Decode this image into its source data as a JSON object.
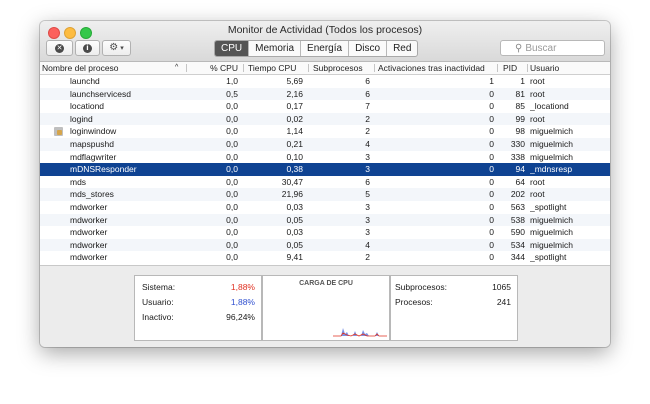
{
  "window": {
    "title": "Monitor de Actividad (Todos los procesos)"
  },
  "toolbar": {
    "stop_icon": "x-circle-icon",
    "info_icon": "info-icon",
    "gear_icon": "gear-icon",
    "tabs": [
      {
        "label": "CPU",
        "active": true
      },
      {
        "label": "Memoria",
        "active": false
      },
      {
        "label": "Energía",
        "active": false
      },
      {
        "label": "Disco",
        "active": false
      },
      {
        "label": "Red",
        "active": false
      }
    ],
    "search_placeholder": "Buscar"
  },
  "table": {
    "columns": [
      "Nombre del proceso",
      "% CPU",
      "Tiempo CPU",
      "Subprocesos",
      "Activaciones tras inactividad",
      "PID",
      "Usuario"
    ],
    "rows": [
      {
        "name": "launchd",
        "cpu": "1,0",
        "time": "5,69",
        "threads": "6",
        "wakes": "1",
        "pid": "1",
        "user": "root"
      },
      {
        "name": "launchservicesd",
        "cpu": "0,5",
        "time": "2,16",
        "threads": "6",
        "wakes": "0",
        "pid": "81",
        "user": "root"
      },
      {
        "name": "locationd",
        "cpu": "0,0",
        "time": "0,17",
        "threads": "7",
        "wakes": "0",
        "pid": "85",
        "user": "_locationd"
      },
      {
        "name": "logind",
        "cpu": "0,0",
        "time": "0,02",
        "threads": "2",
        "wakes": "0",
        "pid": "99",
        "user": "root"
      },
      {
        "name": "loginwindow",
        "cpu": "0,0",
        "time": "1,14",
        "threads": "2",
        "wakes": "0",
        "pid": "98",
        "user": "miguelmich"
      },
      {
        "name": "mapspushd",
        "cpu": "0,0",
        "time": "0,21",
        "threads": "4",
        "wakes": "0",
        "pid": "330",
        "user": "miguelmich"
      },
      {
        "name": "mdflagwriter",
        "cpu": "0,0",
        "time": "0,10",
        "threads": "3",
        "wakes": "0",
        "pid": "338",
        "user": "miguelmich"
      },
      {
        "name": "mDNSResponder",
        "cpu": "0,0",
        "time": "0,38",
        "threads": "3",
        "wakes": "0",
        "pid": "94",
        "user": "_mdnsresp"
      },
      {
        "name": "mds",
        "cpu": "0,0",
        "time": "30,47",
        "threads": "6",
        "wakes": "0",
        "pid": "64",
        "user": "root"
      },
      {
        "name": "mds_stores",
        "cpu": "0,0",
        "time": "21,96",
        "threads": "5",
        "wakes": "0",
        "pid": "202",
        "user": "root"
      },
      {
        "name": "mdworker",
        "cpu": "0,0",
        "time": "0,03",
        "threads": "3",
        "wakes": "0",
        "pid": "563",
        "user": "_spotlight"
      },
      {
        "name": "mdworker",
        "cpu": "0,0",
        "time": "0,05",
        "threads": "3",
        "wakes": "0",
        "pid": "538",
        "user": "miguelmich"
      },
      {
        "name": "mdworker",
        "cpu": "0,0",
        "time": "0,03",
        "threads": "3",
        "wakes": "0",
        "pid": "590",
        "user": "miguelmich"
      },
      {
        "name": "mdworker",
        "cpu": "0,0",
        "time": "0,05",
        "threads": "4",
        "wakes": "0",
        "pid": "534",
        "user": "miguelmich"
      },
      {
        "name": "mdworker",
        "cpu": "0,0",
        "time": "9,41",
        "threads": "2",
        "wakes": "0",
        "pid": "344",
        "user": "_spotlight"
      }
    ],
    "selected_row": 7
  },
  "summary": {
    "system_label": "Sistema:",
    "system_value": "1,88%",
    "user_label": "Usuario:",
    "user_value": "1,88%",
    "idle_label": "Inactivo:",
    "idle_value": "96,24%",
    "graph_title": "CARGA DE CPU",
    "threads_label": "Subprocesos:",
    "threads_value": "1065",
    "processes_label": "Procesos:",
    "processes_value": "241"
  },
  "colors": {
    "selection": "#0f4392",
    "system": "#e03020",
    "user": "#3050d0"
  }
}
